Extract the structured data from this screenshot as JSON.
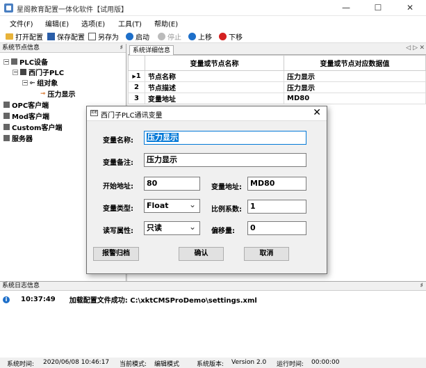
{
  "window": {
    "title": "星阁教育配置一体化软件【试用版】",
    "minimize": "—",
    "maximize": "☐",
    "close": "✕"
  },
  "menu": [
    "文件(F)",
    "编辑(E)",
    "选项(E)",
    "工具(T)",
    "帮助(E)"
  ],
  "toolbar": {
    "open": "打开配置",
    "save": "保存配置",
    "save_as": "另存为",
    "start": "启动",
    "stop": "停止",
    "up": "上移",
    "down": "下移"
  },
  "left_pane": {
    "title": "系统节点信息",
    "pin": "♯",
    "tree": {
      "plc": "PLC设备",
      "siemens": "西门子PLC",
      "group": "组对象",
      "pressure": "压力显示",
      "opc": "OPC客户端",
      "mod": "Mod客户端",
      "custom": "Custom客户端",
      "server": "服务器"
    }
  },
  "right_pane": {
    "tab": "系统详细信息",
    "nav_left": "◁",
    "nav_right": "▷",
    "nav_close": "✕",
    "headers": [
      "变量或节点名称",
      "变量或节点对应数据值"
    ],
    "rows": [
      {
        "idx": "1",
        "name": "节点名称",
        "value": "压力显示"
      },
      {
        "idx": "2",
        "name": "节点描述",
        "value": "压力显示"
      },
      {
        "idx": "3",
        "name": "变量地址",
        "value": "MD80"
      }
    ]
  },
  "log": {
    "title": "系统日志信息",
    "pin": "♯",
    "entries": [
      {
        "time": "10:37:49",
        "message": "加载配置文件成功: C:\\xktCMSProDemo\\settings.xml"
      }
    ]
  },
  "status": {
    "time_label": "系统时间:",
    "time": "2020/06/08 10:46:17",
    "mode_label": "当前模式:",
    "mode": "编辑模式",
    "version_label": "系统版本:",
    "version": "Version  2.0",
    "run_label": "运行时间:",
    "run": "00:00:00"
  },
  "dialog": {
    "title": "西门子PLC通讯变量",
    "close": "✕",
    "var_name_label": "变量名称:",
    "var_name": "压力显示",
    "var_note_label": "变量备注:",
    "var_note": "压力显示",
    "start_addr_label": "开始地址:",
    "start_addr": "80",
    "var_addr_label": "变量地址:",
    "var_addr": "MD80",
    "var_type_label": "变量类型:",
    "var_type": "Float",
    "scale_label": "比例系数:",
    "scale": "1",
    "rw_label": "读写属性:",
    "rw": "只读",
    "offset_label": "偏移量:",
    "offset": "0",
    "alarm_btn": "报警归档",
    "ok_btn": "确认",
    "cancel_btn": "取消"
  },
  "colors": {
    "accent": "#0078d7",
    "selection": "#0078d7",
    "info_icon": "#1e6fc9",
    "down_icon": "#d42020"
  }
}
